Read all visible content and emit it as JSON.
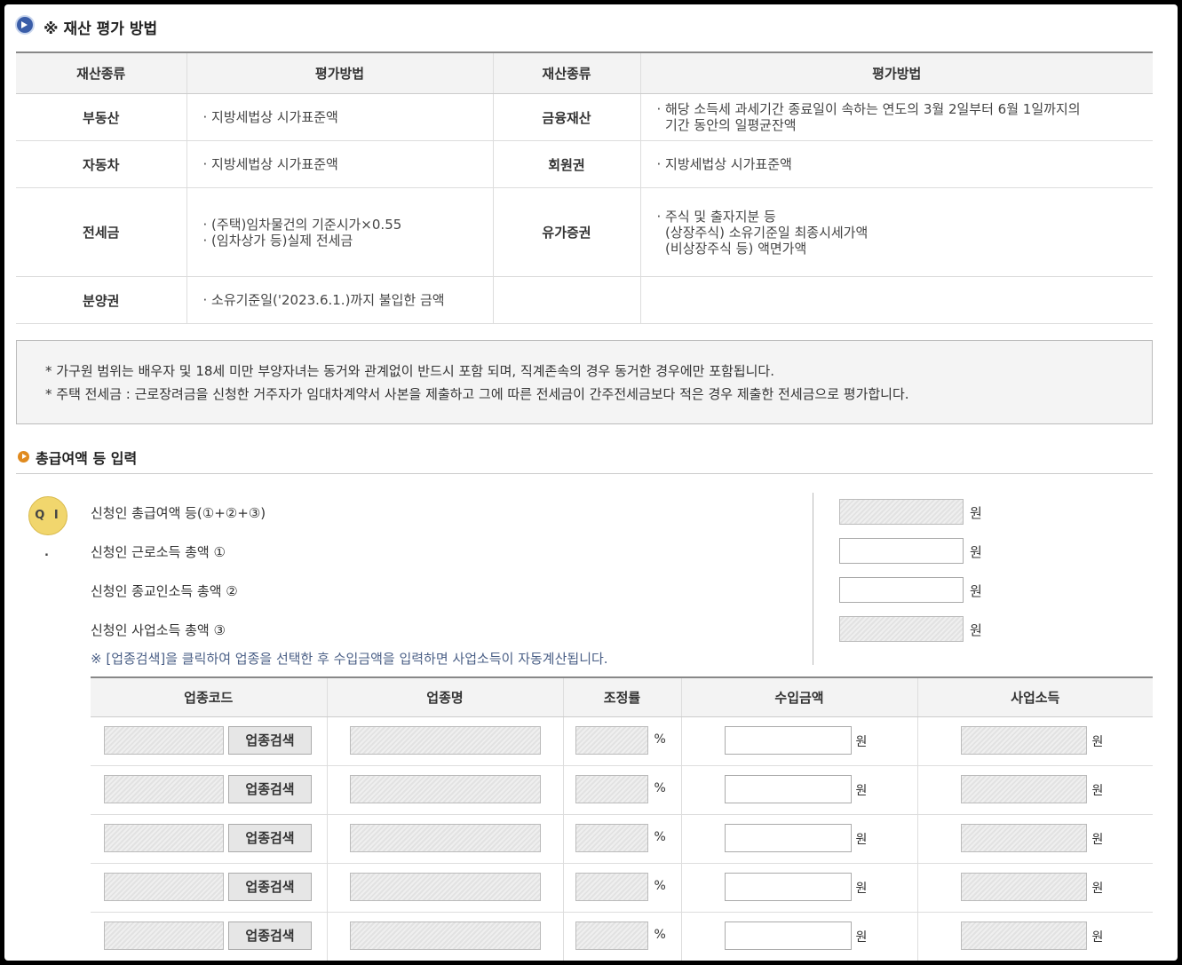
{
  "section1": {
    "title": "※ 재산 평가 방법",
    "headers": [
      "재산종류",
      "평가방법",
      "재산종류",
      "평가방법"
    ],
    "rows": [
      {
        "k1": "부동산",
        "d1": [
          "· 지방세법상 시가표준액"
        ],
        "k2": "금융재산",
        "d2": [
          "· 해당 소득세 과세기간 종료일이 속하는 연도의 3월 2일부터 6월 1일까지의",
          "  기간 동안의 일평균잔액"
        ]
      },
      {
        "k1": "자동차",
        "d1": [
          "· 지방세법상 시가표준액"
        ],
        "k2": "회원권",
        "d2": [
          "· 지방세법상 시가표준액"
        ]
      },
      {
        "k1": "전세금",
        "d1": [
          "· (주택)임차물건의 기준시가×0.55",
          "· (임차상가 등)실제 전세금"
        ],
        "k2": "유가증권",
        "d2": [
          "· 주식 및 출자지분 등",
          "  (상장주식) 소유기준일 최종시세가액",
          "  (비상장주식 등) 액면가액"
        ]
      },
      {
        "k1": "분양권",
        "d1": [
          "· 소유기준일('2023.6.1.)까지 불입한 금액"
        ],
        "k2": "",
        "d2": []
      }
    ]
  },
  "notes": [
    "* 가구원 범위는 배우자 및 18세 미만 부양자녀는 동거와 관계없이 반드시 포함 되며, 직계존속의 경우 동거한 경우에만 포함됩니다.",
    "* 주택 전세금 : 근로장려금을 신청한 거주자가 임대차계약서 사본을 제출하고 그에 따른 전세금이 간주전세금보다 적은 경우 제출한 전세금으로 평가합니다."
  ],
  "section2": {
    "title": "총급여액 등 입력",
    "badge": "Q I .",
    "fields": [
      {
        "label": "신청인 총급여액 등(①+②+③)",
        "value": "",
        "readonly": true,
        "unit": "원"
      },
      {
        "label": "신청인 근로소득 총액 ①",
        "value": "",
        "readonly": false,
        "unit": "원"
      },
      {
        "label": "신청인 종교인소득 총액 ②",
        "value": "",
        "readonly": false,
        "unit": "원"
      },
      {
        "label": "신청인 사업소득 총액 ③",
        "value": "",
        "readonly": true,
        "unit": "원"
      }
    ],
    "hint": "※ [업종검색]을 클릭하여 업종을 선택한 후 수입금액을 입력하면 사업소득이 자동계산됩니다."
  },
  "industry": {
    "headers": [
      "업종코드",
      "업종명",
      "조정률",
      "수입금액",
      "사업소득"
    ],
    "search_label": "업종검색",
    "pct_unit": "%",
    "won_unit": "원",
    "rows": [
      {
        "code": "",
        "name": "",
        "rate": "",
        "revenue": "",
        "income": ""
      },
      {
        "code": "",
        "name": "",
        "rate": "",
        "revenue": "",
        "income": ""
      },
      {
        "code": "",
        "name": "",
        "rate": "",
        "revenue": "",
        "income": ""
      },
      {
        "code": "",
        "name": "",
        "rate": "",
        "revenue": "",
        "income": ""
      },
      {
        "code": "",
        "name": "",
        "rate": "",
        "revenue": "",
        "income": ""
      }
    ]
  },
  "colors": {
    "accent_blue": "#3a5da8",
    "accent_orange": "#e08a1e",
    "badge_yellow": "#f1d66d",
    "hint_text": "#4a5f86"
  }
}
